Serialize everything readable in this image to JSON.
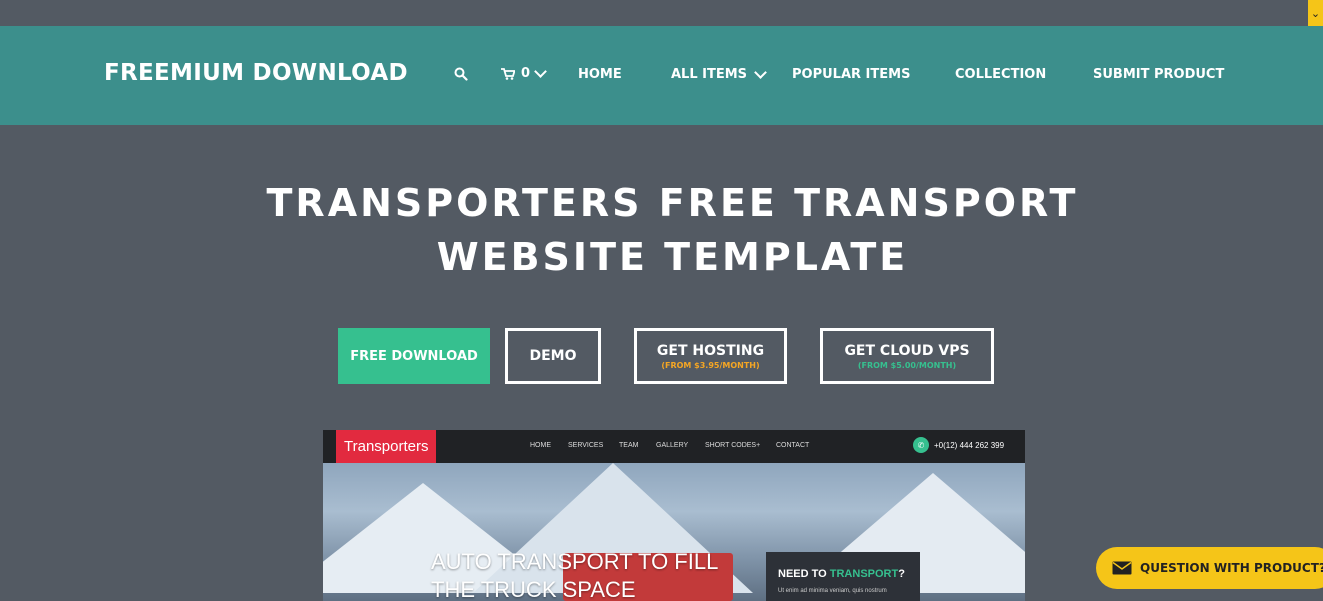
{
  "header": {
    "brand": "FREEMIUM DOWNLOAD",
    "cart_count": "0",
    "nav": {
      "home": "HOME",
      "all_items": "ALL ITEMS",
      "popular_items": "POPULAR ITEMS",
      "collection": "COLLECTION",
      "submit_product": "SUBMIT PRODUCT"
    }
  },
  "hero": {
    "title_line1": "TRANSPORTERS FREE TRANSPORT",
    "title_line2": "WEBSITE TEMPLATE"
  },
  "buttons": {
    "free_download": "FREE DOWNLOAD",
    "demo": "DEMO",
    "get_hosting": "GET HOSTING",
    "get_hosting_sub": "(FROM $3.95/MONTH)",
    "get_cloud_vps": "GET CLOUD VPS",
    "get_cloud_vps_sub": "(FROM $5.00/MONTH)"
  },
  "preview": {
    "brand": "Transporters",
    "nav": [
      "HOME",
      "SERVICES",
      "TEAM",
      "GALLERY",
      "SHORT CODES+",
      "CONTACT"
    ],
    "phone": "+0(12) 444 262 399",
    "headline_line1": "AUTO TRANSPORT TO FILL",
    "headline_line2": "THE TRUCK SPACE",
    "need_prefix": "NEED TO ",
    "need_highlight": "TRANSPORT",
    "need_suffix": "?",
    "need_text": "Ut enim ad minima veniam, quis nostrum"
  },
  "question_widget": {
    "label": "QUESTION WITH PRODUCT?"
  },
  "colors": {
    "page_bg": "#535a63",
    "nav_bg": "#3c8f8c",
    "primary_green": "#36c08f",
    "hosting_sub": "#f5a623",
    "vps_sub": "#36c08f",
    "widget_yellow": "#f5c518",
    "preview_brand_red": "#e22a3f"
  },
  "icons": {
    "search": "search-icon",
    "cart": "cart-icon",
    "mail": "mail-icon",
    "phone": "phone-icon"
  }
}
